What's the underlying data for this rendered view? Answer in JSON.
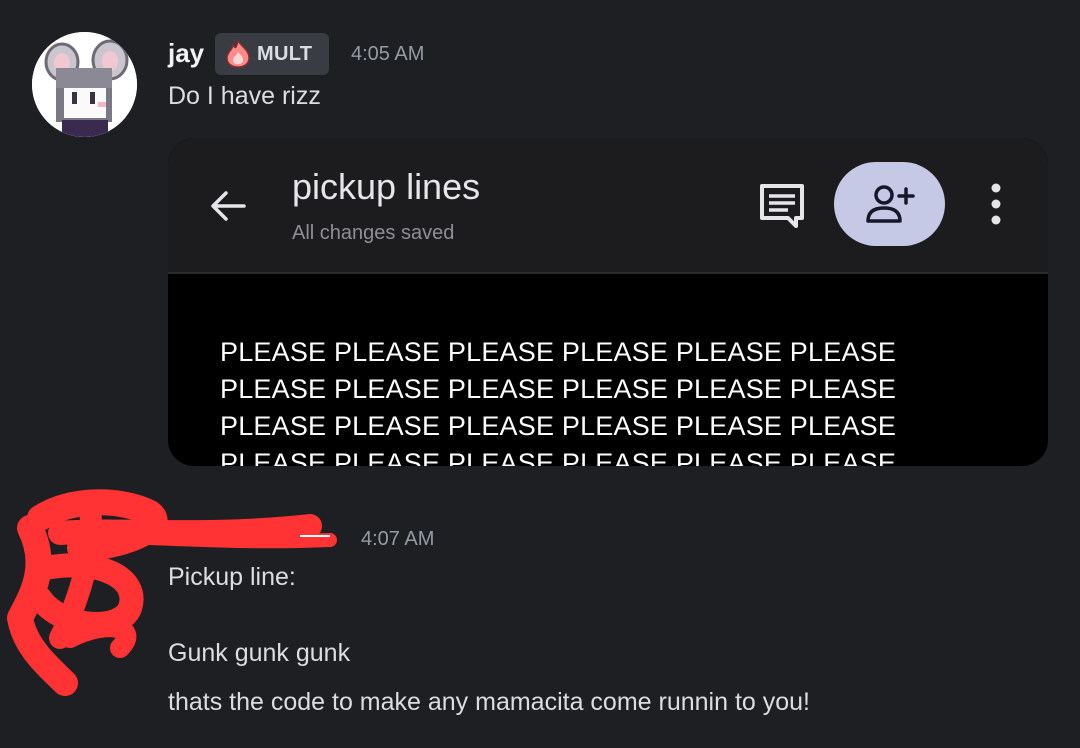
{
  "message1": {
    "username": "jay",
    "tag": "MULT",
    "time": "4:05 AM",
    "text": "Do I have rizz"
  },
  "embed": {
    "doc_title": "pickup lines",
    "doc_status": "All changes saved",
    "icons": [
      "back-arrow-icon",
      "comment-icon",
      "add-person-icon",
      "more-vert-icon"
    ],
    "body_lines": [
      "PLEASE PLEASE PLEASE PLEASE PLEASE PLEASE",
      "PLEASE PLEASE PLEASE PLEASE PLEASE PLEASE",
      "PLEASE PLEASE PLEASE PLEASE PLEASE PLEASE",
      "PLEASE PLEASE PLEASE PLEASE PLEASE PLEASE"
    ],
    "accent": "#c6c9e6"
  },
  "message2": {
    "time": "4:07 AM",
    "line1": "Pickup line:",
    "line2": "Gunk gunk gunk",
    "line3": "thats the code to make any mamacita come runnin to you!",
    "redaction_color": "#ff3333"
  }
}
